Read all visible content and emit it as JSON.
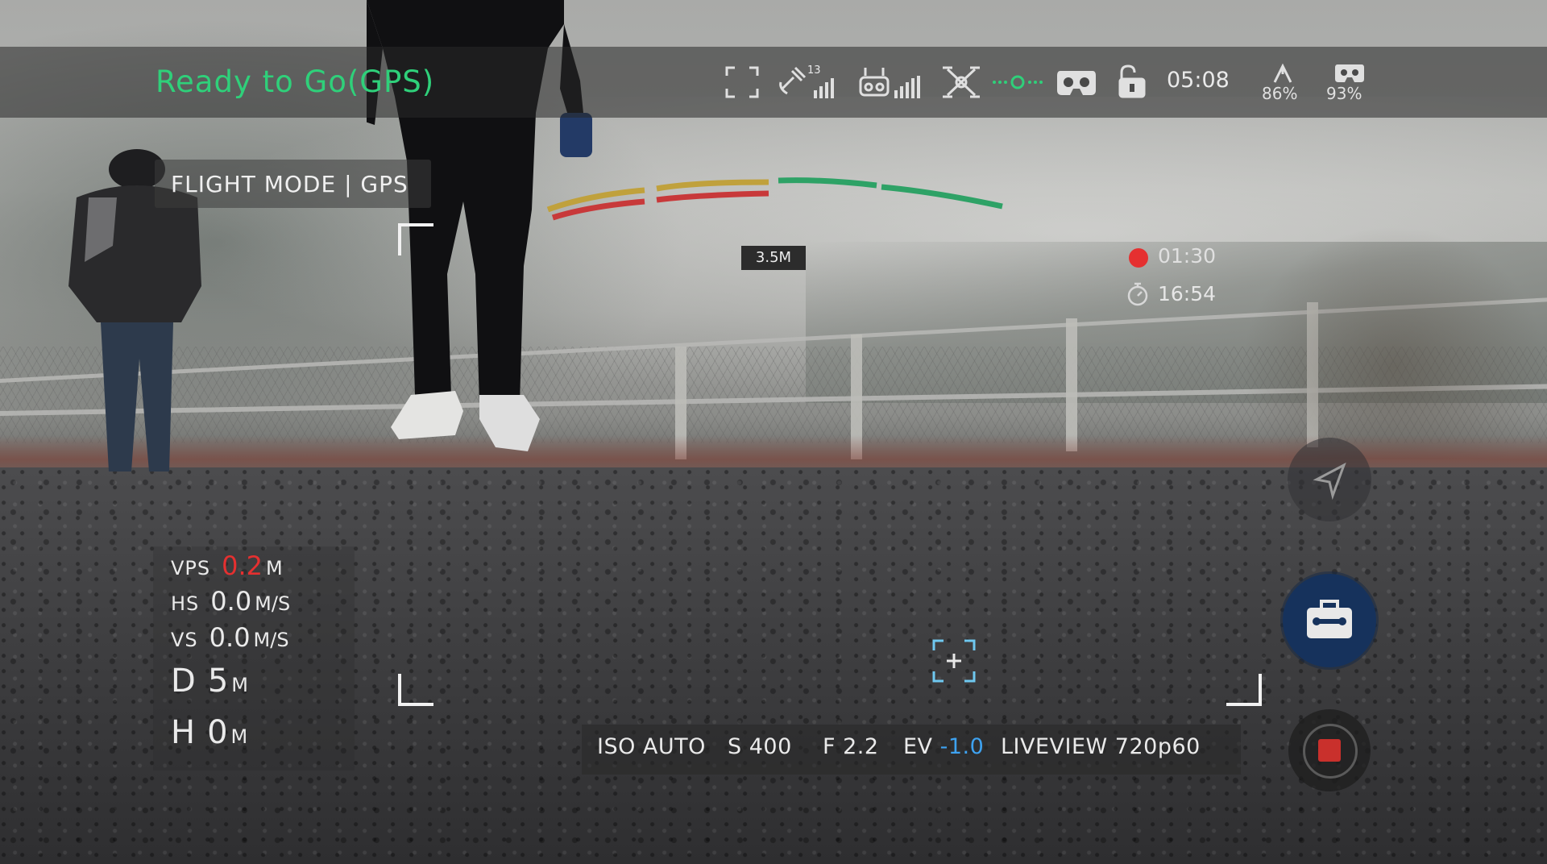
{
  "status": {
    "text": "Ready to Go(GPS)",
    "color": "#2fd07a"
  },
  "topbar": {
    "icons": [
      "frame-icon",
      "satellite-icon",
      "signal-bars-icon",
      "remote-controller-icon",
      "drone-icon",
      "obstacle-sensing-icon",
      "vr-goggles-icon",
      "unlock-icon",
      "drone-battery-icon",
      "goggles-battery-icon"
    ],
    "gps_sat_count": "13",
    "flight_time": "05:08",
    "drone_battery": "86%",
    "goggles_battery": "93%"
  },
  "flight_mode": {
    "label": "FLIGHT MODE | GPS"
  },
  "obstacle": {
    "distance": "3.5M"
  },
  "recording": {
    "rec_time": "01:30",
    "remaining_time": "16:54",
    "rec_color": "#e53030"
  },
  "telemetry": {
    "vps": {
      "label": "VPS",
      "value": "0.2",
      "unit": "M",
      "value_color": "#e53030"
    },
    "hs": {
      "label": "HS",
      "value": "0.0",
      "unit": "M/S"
    },
    "vs": {
      "label": "VS",
      "value": "0.0",
      "unit": "M/S"
    },
    "d": {
      "label": "D",
      "value": "5",
      "unit": "M"
    },
    "h": {
      "label": "H",
      "value": "0",
      "unit": "M"
    }
  },
  "camera": {
    "iso": "ISO AUTO",
    "shutter": "S 400",
    "aperture": "F 2.2",
    "ev_label": "EV",
    "ev_value": "-1.0",
    "liveview": "LIVEVIEW 720p60",
    "ev_color": "#3ea2f0"
  },
  "buttons": {
    "navigation": "navigation-icon",
    "toolbox": "toolbox-icon",
    "record": "record-stop-icon"
  }
}
